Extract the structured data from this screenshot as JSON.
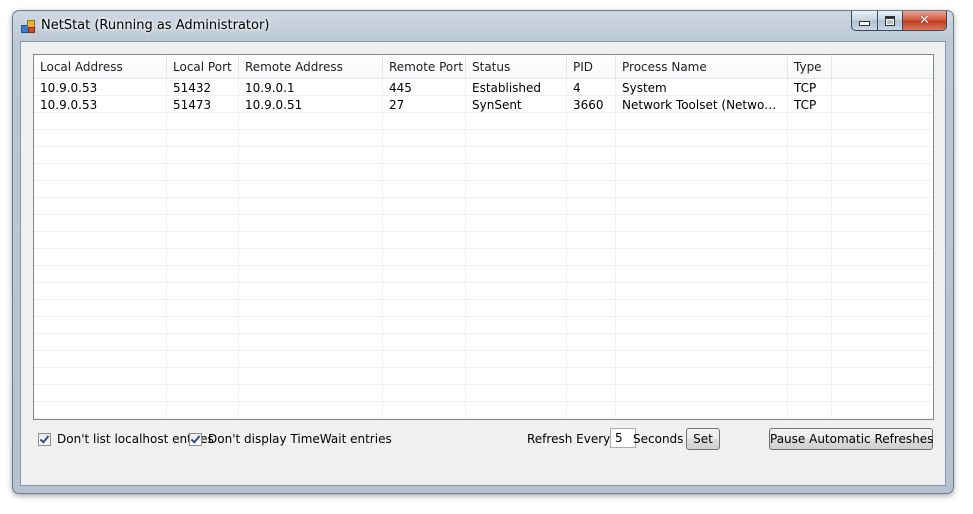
{
  "window": {
    "title": "NetStat (Running as Administrator)",
    "controls": {
      "minimize": "minimize-icon",
      "maximize": "maximize-icon",
      "close": "close-icon"
    }
  },
  "table": {
    "columns": [
      "Local Address",
      "Local Port",
      "Remote Address",
      "Remote Port",
      "Status",
      "PID",
      "Process Name",
      "Type"
    ],
    "rows": [
      [
        "10.9.0.53",
        "51432",
        "10.9.0.1",
        "445",
        "Established",
        "4",
        "System",
        "TCP"
      ],
      [
        "10.9.0.53",
        "51473",
        "10.9.0.51",
        "27",
        "SynSent",
        "3660",
        "Network Toolset (Network Tool...",
        "TCP"
      ]
    ]
  },
  "options": {
    "no_localhost": {
      "label": "Don't list localhost entries",
      "checked": true
    },
    "no_timewait": {
      "label": "Don't display TimeWait entries",
      "checked": true
    }
  },
  "refresh": {
    "prefix": "Refresh Every",
    "value": "5",
    "suffix": "Seconds",
    "set_label": "Set",
    "pause_label": "Pause Automatic Refreshes"
  }
}
